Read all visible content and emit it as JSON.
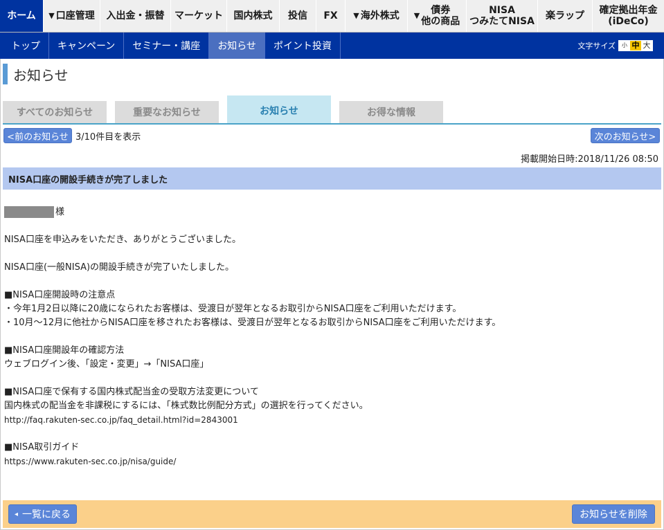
{
  "top_nav": [
    {
      "label": "ホーム",
      "dropdown": false
    },
    {
      "label": "口座管理",
      "dropdown": true
    },
    {
      "label": "入出金・振替",
      "dropdown": false
    },
    {
      "label": "マーケット",
      "dropdown": false
    },
    {
      "label": "国内株式",
      "dropdown": false
    },
    {
      "label": "投信",
      "dropdown": false
    },
    {
      "label": "FX",
      "dropdown": false
    },
    {
      "label": "海外株式",
      "dropdown": true
    },
    {
      "label": "債券\n他の商品",
      "dropdown": true
    },
    {
      "label": "NISA\nつみたてNISA",
      "dropdown": false
    },
    {
      "label": "楽ラップ",
      "dropdown": false
    },
    {
      "label": "確定拠出年金\n(iDeCo)",
      "dropdown": false
    }
  ],
  "sub_nav": [
    "トップ",
    "キャンペーン",
    "セミナー・講座",
    "お知らせ",
    "ポイント投資"
  ],
  "font_size": {
    "label": "文字サイズ",
    "small": "小",
    "medium": "中",
    "large": "大"
  },
  "page_title": "お知らせ",
  "tabs": [
    "すべてのお知らせ",
    "重要なお知らせ",
    "お知らせ",
    "お得な情報"
  ],
  "pager": {
    "prev": "<前のお知らせ",
    "next": "次のお知らせ>",
    "status": "3/10件目を表示"
  },
  "posted": "掲載開始日時:2018/11/26 08:50",
  "subject": "NISA口座の開設手続きが完了しました",
  "message": {
    "salutation": "様",
    "l1": "NISA口座を申込みをいただき、ありがとうございました。",
    "l2": "NISA口座(一般NISA)の開設手続きが完了いたしました。",
    "h1": "■NISA口座開設時の注意点",
    "h1a": "・今年1月2日以降に20歳になられたお客様は、受渡日が翌年となるお取引からNISA口座をご利用いただけます。",
    "h1b": "・10月～12月に他社からNISA口座を移されたお客様は、受渡日が翌年となるお取引からNISA口座をご利用いただけます。",
    "h2": "■NISA口座開設年の確認方法",
    "h2a": "ウェブログイン後、「設定・変更」→「NISA口座」",
    "h3": "■NISA口座で保有する国内株式配当金の受取方法変更について",
    "h3a": "国内株式の配当金を非課税にするには、「株式数比例配分方式」の選択を行ってください。",
    "h3b": "http://faq.rakuten-sec.co.jp/faq_detail.html?id=2843001",
    "h4": "■NISA取引ガイド",
    "h4a": "https://www.rakuten-sec.co.jp/nisa/guide/"
  },
  "bottom": {
    "back": "一覧に戻る",
    "delete": "お知らせを削除"
  }
}
